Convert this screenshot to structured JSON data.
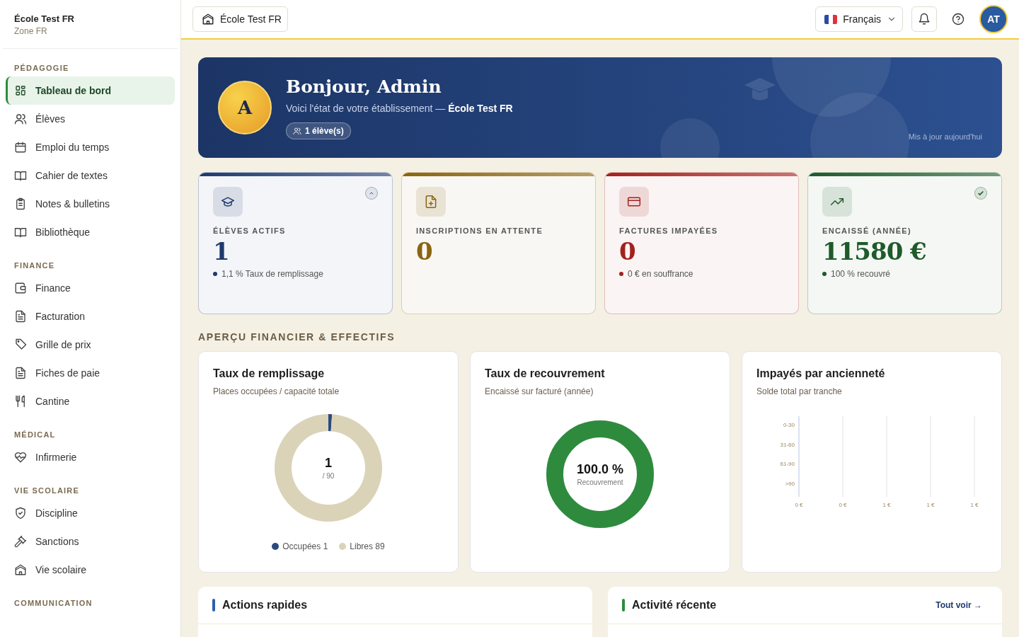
{
  "school": {
    "name": "École Test FR",
    "zone": "Zone FR"
  },
  "sidebar": {
    "sections": [
      {
        "title": "PÉDAGOGIE",
        "items": [
          {
            "label": "Tableau de bord",
            "selected": true
          },
          {
            "label": "Élèves",
            "selected": false
          },
          {
            "label": "Emploi du temps",
            "selected": false
          },
          {
            "label": "Cahier de textes",
            "selected": false
          },
          {
            "label": "Notes & bulletins",
            "selected": false
          },
          {
            "label": "Bibliothèque",
            "selected": false
          }
        ]
      },
      {
        "title": "FINANCE",
        "items": [
          {
            "label": "Finance",
            "selected": false
          },
          {
            "label": "Facturation",
            "selected": false
          },
          {
            "label": "Grille de prix",
            "selected": false
          },
          {
            "label": "Fiches de paie",
            "selected": false
          },
          {
            "label": "Cantine",
            "selected": false
          }
        ]
      },
      {
        "title": "MÉDICAL",
        "items": [
          {
            "label": "Infirmerie",
            "selected": false
          }
        ]
      },
      {
        "title": "VIE SCOLAIRE",
        "items": [
          {
            "label": "Discipline",
            "selected": false
          },
          {
            "label": "Sanctions",
            "selected": false
          },
          {
            "label": "Vie scolaire",
            "selected": false
          }
        ]
      },
      {
        "title": "COMMUNICATION"
      }
    ]
  },
  "topbar": {
    "school_button": "École Test FR",
    "language": "Français",
    "avatar": "AT"
  },
  "hero": {
    "avatar": "A",
    "title": "Bonjour, Admin",
    "subtitle": "Voici l'état de votre établissement — **École Test FR**",
    "pill": "1 élève(s)",
    "updated": "Mis à jour aujourd'hui"
  },
  "stats": [
    {
      "label": "ÉLÈVES ACTIFS",
      "value": "1",
      "note": "1,1 % Taux de remplissage",
      "color": "#1e3a6e",
      "kind": "collapsible"
    },
    {
      "label": "INSCRIPTIONS EN ATTENTE",
      "value": "0",
      "color": "#8a6410",
      "kind": "plain"
    },
    {
      "label": "FACTURES IMPAYÉES",
      "value": "0",
      "note": "0 € en souffrance",
      "color": "#a3221c",
      "kind": "plain"
    },
    {
      "label": "ENCAISSÉ (ANNÉE)",
      "value": "11580 €",
      "note": "100 % recouvré",
      "color": "#1f5a2a",
      "kind": "verified"
    }
  ],
  "overview_title": "APERÇU FINANCIER & EFFECTIFS",
  "fill_rate": {
    "title": "Taux de remplissage",
    "subtitle": "Places occupées / capacité totale",
    "center": "1",
    "center_sub": "/ 90",
    "chart_data": {
      "type": "donut",
      "categories": [
        "Occupées",
        "Libres"
      ],
      "values": [
        1.11,
        98.89
      ]
    },
    "legend": [
      {
        "value": "1",
        "color": "#2c4a80"
      },
      {
        "value": "89",
        "color": "#dbd3b8"
      }
    ]
  },
  "recovery": {
    "title": "Taux de recouvrement",
    "subtitle": "Encaissé sur facturé (année)",
    "center": "100.0 %",
    "center_sub": "Recouvrement",
    "level": 1
  },
  "aging": {
    "title": "Impayés par ancienneté",
    "subtitle": "Solde total par tranche",
    "chart_data": {
      "type": "bar",
      "orientation": "horizontal",
      "categories": [
        "0-30",
        "31-60",
        "61-90",
        ">90"
      ],
      "values": [
        0,
        0,
        0,
        0
      ],
      "xlim": [
        0,
        1
      ],
      "grid": true,
      "xticks": [
        {
          "value": 0,
          "label": "0 €"
        },
        {
          "value": 0.25,
          "label": "0 €"
        },
        {
          "value": 0.5,
          "label": "1 €"
        },
        {
          "value": 0.75,
          "label": "1 €"
        },
        {
          "value": 1,
          "label": "1 €"
        }
      ]
    }
  },
  "panels": [
    {
      "title": "Actions rapides",
      "color": "#2f5fa8"
    },
    {
      "title": "Activité récente",
      "color": "#2e8b3e",
      "link": "Tout voir →"
    }
  ]
}
